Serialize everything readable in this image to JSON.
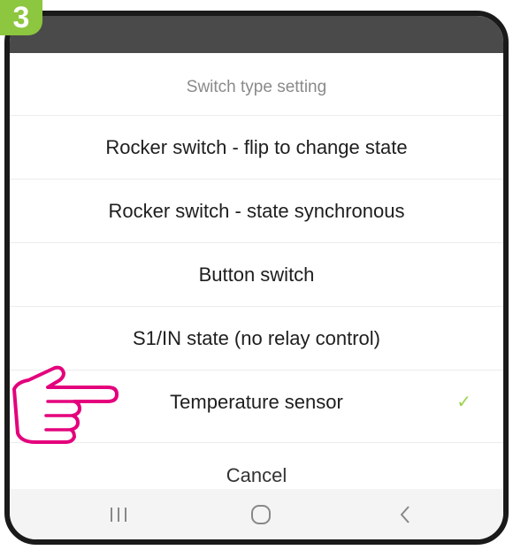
{
  "step_number": "3",
  "dialog": {
    "title": "Switch type setting",
    "options": [
      "Rocker switch - flip to change state",
      "Rocker switch - state synchronous",
      "Button switch",
      "S1/IN state (no relay control)",
      "Temperature sensor"
    ],
    "selected_index": 4,
    "checkmark": "✓",
    "cancel_label": "Cancel"
  },
  "nav_bar": {
    "recent_icon": "recent-apps-icon",
    "home_icon": "home-icon",
    "back_icon": "back-icon"
  },
  "colors": {
    "step_badge": "#8dc63f",
    "checkmark": "#9bd24b",
    "hand_outline": "#e4007c",
    "status_bar": "#4a4a4a"
  }
}
